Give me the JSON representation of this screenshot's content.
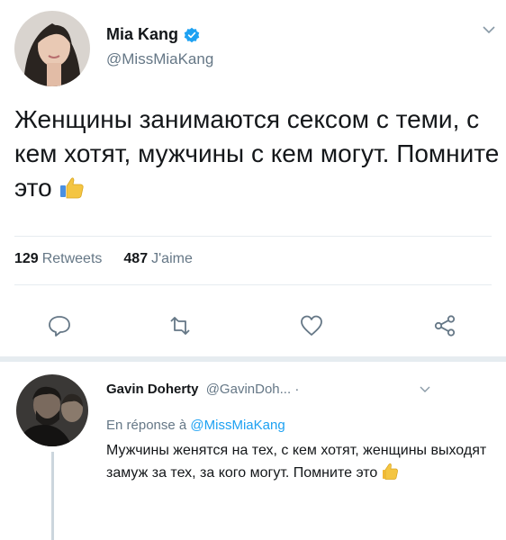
{
  "tweet": {
    "author_name": "Mia Kang",
    "author_handle": "@MissMiaKang",
    "text": "Женщины занимаются сексом с теми, с кем хотят, мужчины с кем могут. Помните это",
    "retweets_count": "129",
    "retweets_label": "Retweets",
    "likes_count": "487",
    "likes_label": "J'aime"
  },
  "reply": {
    "author_name": "Gavin Doherty",
    "author_handle": "@GavinDoh...",
    "dot": "·",
    "in_reply_prefix": "En réponse à",
    "in_reply_handle": "@MissMiaKang",
    "text": "Мужчины женятся на тех, с кем хотят, женщины выходят замуж за тех, за кого могут. Помните это"
  },
  "colors": {
    "verified": "#1da1f2",
    "link": "#1da1f2",
    "muted": "#657786",
    "thumb": "#f4c542"
  },
  "icons": [
    "verified-badge-icon",
    "chevron-down-icon",
    "reply-icon",
    "retweet-icon",
    "like-heart-icon",
    "share-icon",
    "thumbs-up-emoji"
  ]
}
